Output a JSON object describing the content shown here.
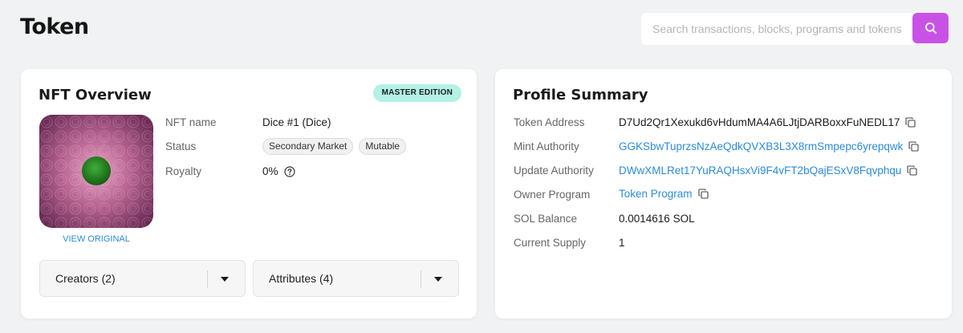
{
  "header": {
    "title": "Token",
    "search": {
      "placeholder": "Search transactions, blocks, programs and tokens",
      "value": ""
    }
  },
  "nft_overview": {
    "title": "NFT Overview",
    "badge": "MASTER EDITION",
    "view_original": "VIEW ORIGINAL",
    "fields": {
      "name_label": "NFT name",
      "name_value": "Dice #1 (Dice)",
      "status_label": "Status",
      "status_chips": [
        "Secondary Market",
        "Mutable"
      ],
      "royalty_label": "Royalty",
      "royalty_value": "0%"
    },
    "accordions": {
      "creators": "Creators (2)",
      "attributes": "Attributes (4)"
    }
  },
  "profile_summary": {
    "title": "Profile Summary",
    "rows": [
      {
        "label": "Token Address",
        "value": "D7Ud2Qr1Xexukd6vHdumMA4A6LJtjDARBoxxFuNEDL17",
        "link": false
      },
      {
        "label": "Mint Authority",
        "value": "GGKSbwTuprzsNzAeQdkQVXB3L3X8rmSmpepc6yrepqwk",
        "link": true
      },
      {
        "label": "Update Authority",
        "value": "DWwXMLRet17YuRAQHsxVi9F4vFT2bQajESxV8Fqvphqu",
        "link": true
      },
      {
        "label": "Owner Program",
        "value": "Token Program",
        "link": true
      },
      {
        "label": "SOL Balance",
        "value": "0.0014616 SOL",
        "link": false
      },
      {
        "label": "Current Supply",
        "value": "1",
        "link": false
      }
    ]
  },
  "colors": {
    "accent": "#c952e6",
    "link": "#2e8ad9",
    "badge_bg": "#b2f1e4"
  }
}
